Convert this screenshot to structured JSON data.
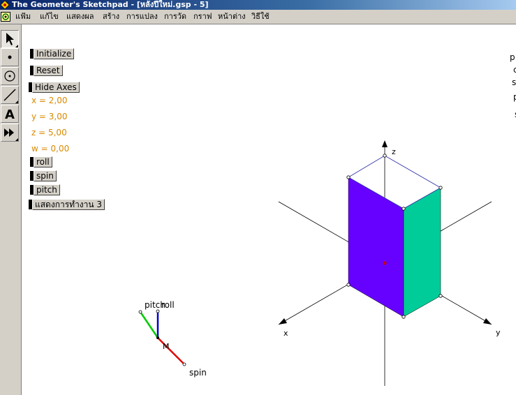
{
  "window": {
    "title": "The Geometer's Sketchpad - [หลังปีใหม่.gsp - 5]"
  },
  "menu": [
    "แฟ้ม",
    "แก้ไข",
    "แสดงผล",
    "สร้าง",
    "การแปลง",
    "การวัด",
    "กราฟ",
    "หน้าต่าง",
    "วิธีใช้"
  ],
  "toolbox": [
    {
      "name": "arrow-icon",
      "active": true
    },
    {
      "name": "point-icon"
    },
    {
      "name": "compass-icon"
    },
    {
      "name": "straightedge-icon"
    },
    {
      "name": "text-icon",
      "glyph": "A"
    },
    {
      "name": "script-icon"
    }
  ],
  "buttons": {
    "initialize": "Initialize",
    "reset": "Reset",
    "hide_axes": "Hide Axes",
    "roll": "roll",
    "spin": "spin",
    "pitch": "pitch",
    "show_action": "แสดงการทำงาน 3"
  },
  "values": {
    "x": "x = 2,00",
    "y": "y = 3,00",
    "z": "z = 5,00",
    "w": "w = 0,00"
  },
  "gimbal": {
    "pitch_label": "pitch",
    "roll_label": "roll",
    "spin_label": "spin",
    "center_label": "M"
  },
  "axes": {
    "x_label": "x",
    "y_label": "y",
    "z_label": "z"
  },
  "right_edge_chars": [
    "p",
    "c",
    "s",
    "p",
    "s"
  ],
  "colors": {
    "face_front": "#6600ff",
    "face_side": "#00cc99",
    "value_text": "#d98a00",
    "pitch_line": "#00cc00",
    "roll_line": "#0000cc",
    "spin_line": "#dd0000",
    "top_edges": "#3333aa"
  }
}
